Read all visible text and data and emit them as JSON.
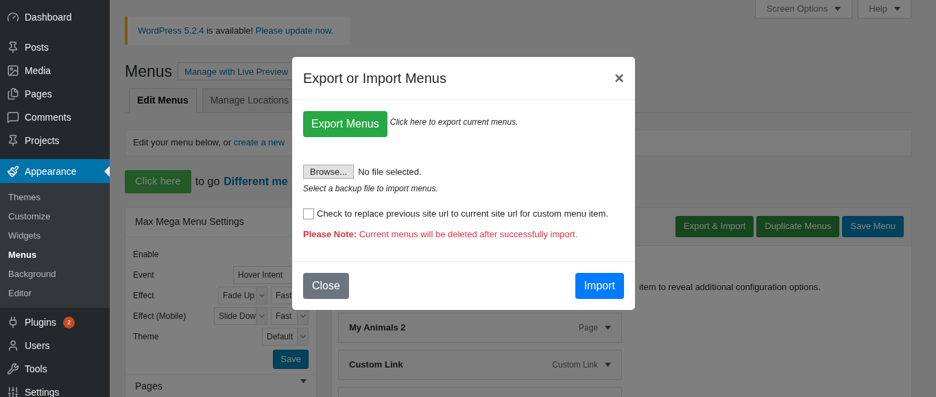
{
  "sidebar": {
    "items": [
      {
        "label": "Dashboard",
        "selected": false
      },
      {
        "label": "Posts",
        "selected": false
      },
      {
        "label": "Media",
        "selected": false
      },
      {
        "label": "Pages",
        "selected": false
      },
      {
        "label": "Comments",
        "selected": false
      },
      {
        "label": "Projects",
        "selected": false
      },
      {
        "label": "Appearance",
        "selected": true,
        "children": [
          {
            "label": "Themes",
            "selected": false
          },
          {
            "label": "Customize",
            "selected": false
          },
          {
            "label": "Widgets",
            "selected": false
          },
          {
            "label": "Menus",
            "selected": true
          },
          {
            "label": "Background",
            "selected": false
          },
          {
            "label": "Editor",
            "selected": false
          }
        ]
      },
      {
        "label": "Plugins",
        "selected": false,
        "badge": "2"
      },
      {
        "label": "Users",
        "selected": false
      },
      {
        "label": "Tools",
        "selected": false
      },
      {
        "label": "Settings",
        "selected": false
      }
    ]
  },
  "top_buttons": [
    "Screen Options",
    "Help"
  ],
  "notice": {
    "link": "WordPress 5.2.4",
    "text": " is available! ",
    "action": "Please update now",
    "end": "."
  },
  "page_title": "Menus",
  "live_preview_button": "Manage with Live Preview",
  "tabs": [
    {
      "label": "Edit Menus",
      "selected": true
    },
    {
      "label": "Manage Locations",
      "selected": false
    }
  ],
  "edit_notice": {
    "text": "Edit your menu below, or ",
    "link": "create a new"
  },
  "click_here": {
    "button": "Click here",
    "text": "to go",
    "link": "Different me"
  },
  "settings_panel": {
    "title": "Max Mega Menu Settings",
    "rows": [
      {
        "label": "Enable",
        "selects": []
      },
      {
        "label": "Event",
        "selects": [
          "Hover Intent"
        ]
      },
      {
        "label": "Effect",
        "selects": [
          "Fade Up",
          "Fast"
        ]
      },
      {
        "label": "Effect (Mobile)",
        "selects": [
          "Slide Dow",
          "Fast"
        ]
      },
      {
        "label": "Theme",
        "selects": [
          "Default"
        ]
      }
    ],
    "save": "Save",
    "next_panel": "Pages"
  },
  "menu_panel": {
    "buttons": [
      {
        "label": "Export & Import",
        "kind": "green"
      },
      {
        "label": "Duplicate Menus",
        "kind": "green"
      },
      {
        "label": "Save Menu",
        "kind": "blue"
      }
    ],
    "hint": "item to reveal additional configuration options.",
    "items": [
      {
        "kind": "item",
        "title": "My Animals 2",
        "type": "Page"
      },
      {
        "kind": "item",
        "title": "Custom Link",
        "type": "Custom Link"
      },
      {
        "kind": "item"
      }
    ]
  },
  "modal": {
    "title": "Export or Import Menus",
    "close_icon": "×",
    "export_button": "Export Menus",
    "export_hint": "Click here to export current menus.",
    "browse_button": "Browse...",
    "file_status": "No file selected.",
    "import_hint": "Select a backup file to import menus.",
    "replace_checkbox": {
      "label": "Check to replace previous site url to current site url for custom menu item.",
      "checked": false
    },
    "note": "**Please Note:** Current menus will be deleted after successfully import.",
    "footer": [
      "Close",
      "Import"
    ]
  }
}
